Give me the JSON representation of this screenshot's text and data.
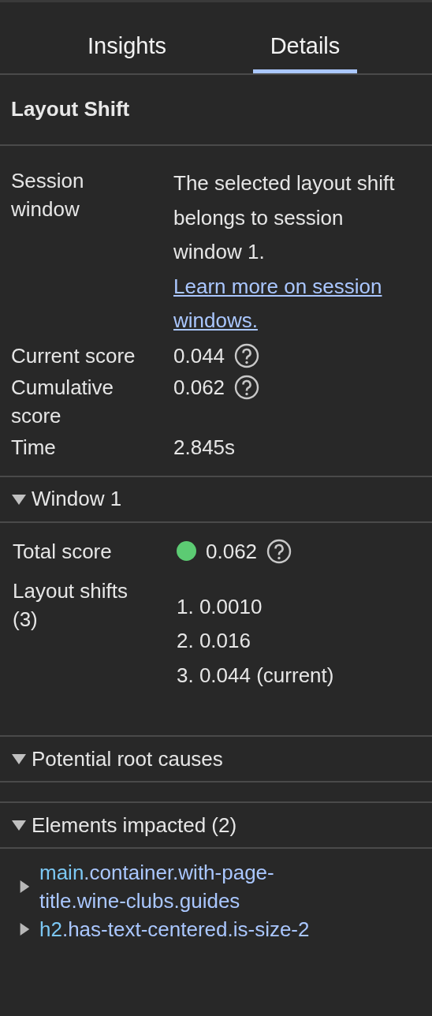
{
  "tabs": [
    {
      "label": "Insights",
      "selected": false
    },
    {
      "label": "Details",
      "selected": true
    }
  ],
  "heading": "Layout Shift",
  "details": [
    {
      "label": "Session window",
      "text": "The selected layout shift belongs to session window 1.",
      "link": "Learn more on session windows."
    },
    {
      "label": "Current score",
      "value": "0.044",
      "help": true
    },
    {
      "label": "Cumulative score",
      "value": "0.062",
      "help": true
    },
    {
      "label": "Time",
      "value": "2.845s",
      "help": false
    }
  ],
  "window_section": {
    "title": "Window 1",
    "expanded": true,
    "total": {
      "label": "Total score",
      "color": "#5ccb73",
      "value": "0.062"
    },
    "shifts_label": "Layout shifts (3)",
    "shifts": [
      "1. 0.0010",
      "2. 0.016",
      "3. 0.044 (current)"
    ]
  },
  "root_causes": {
    "title": "Potential root causes",
    "expanded": true
  },
  "elements": {
    "title": "Elements impacted (2)",
    "expanded": true,
    "items": [
      {
        "tag": "main",
        "classes": ".container.with-page-title.wine-clubs.guides",
        "expanded": false
      },
      {
        "tag": "h2",
        "classes": ".has-text-centered.is-size-2",
        "expanded": false
      }
    ]
  }
}
